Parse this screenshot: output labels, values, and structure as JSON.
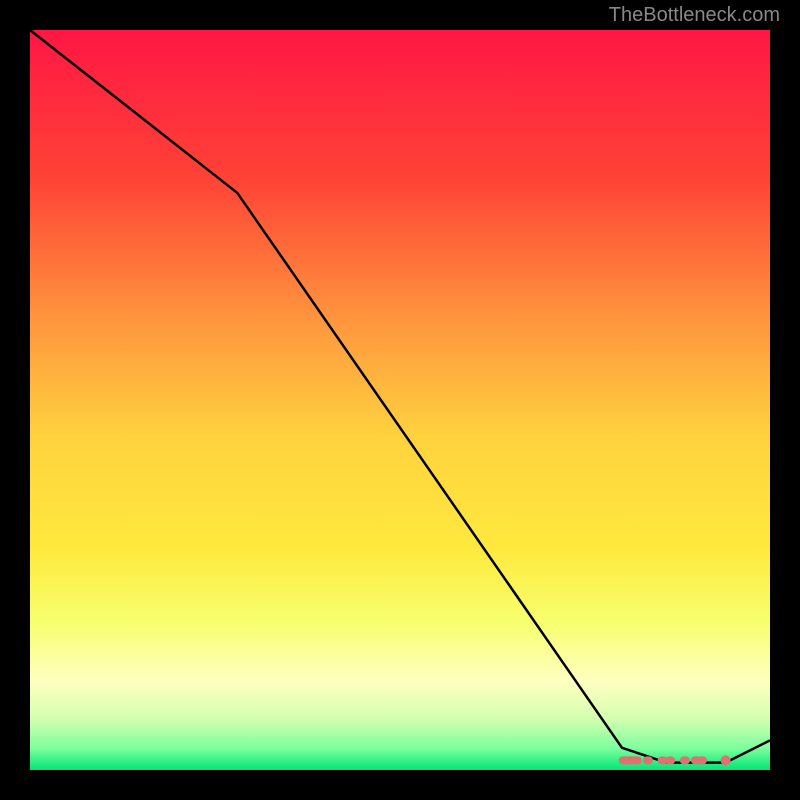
{
  "watermark": "TheBottleneck.com",
  "chart_data": {
    "type": "line",
    "title": "",
    "xlabel": "",
    "ylabel": "",
    "xlim": [
      0,
      100
    ],
    "ylim": [
      0,
      100
    ],
    "series": [
      {
        "name": "curve",
        "x": [
          0,
          28,
          80,
          86,
          94,
          100
        ],
        "values": [
          100,
          78,
          3,
          1,
          1,
          4
        ]
      }
    ],
    "markers": [
      {
        "x": 82,
        "y": 2
      },
      {
        "x": 83.5,
        "y": 2
      },
      {
        "x": 85.5,
        "y": 2
      },
      {
        "x": 86.5,
        "y": 2
      },
      {
        "x": 88.5,
        "y": 2
      },
      {
        "x": 90,
        "y": 2
      },
      {
        "x": 90.8,
        "y": 2
      },
      {
        "x": 94,
        "y": 2
      }
    ],
    "marker_color": "#e27070",
    "gradient_stops": [
      {
        "offset": 0,
        "color": "#ff1744"
      },
      {
        "offset": 0.2,
        "color": "#ff4236"
      },
      {
        "offset": 0.4,
        "color": "#ff993e"
      },
      {
        "offset": 0.55,
        "color": "#ffd23e"
      },
      {
        "offset": 0.7,
        "color": "#ffe93e"
      },
      {
        "offset": 0.8,
        "color": "#f7ff6e"
      },
      {
        "offset": 0.88,
        "color": "#ffffc0"
      },
      {
        "offset": 0.93,
        "color": "#d4ffb0"
      },
      {
        "offset": 0.97,
        "color": "#7fff9e"
      },
      {
        "offset": 1.0,
        "color": "#00e676"
      }
    ]
  }
}
